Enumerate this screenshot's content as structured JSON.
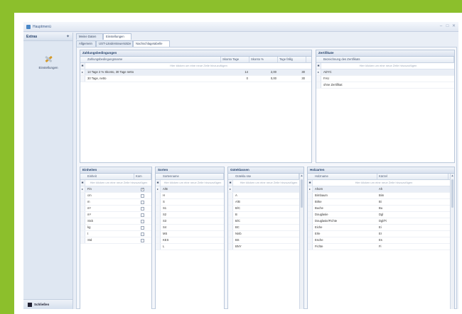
{
  "window": {
    "title": "Hauptmenü",
    "controls": [
      "–",
      "□",
      "✕"
    ]
  },
  "sidebar": {
    "header": "Extras",
    "pin": "✦",
    "item_label": "Einstellungen",
    "bottom_label": "Schließen"
  },
  "tabs_level1": [
    "Meine Daten",
    "Einstellungen"
  ],
  "tabs_level2": [
    "Allgemein",
    "UST-Ländersteuersätze",
    "Nachschlagetabelle"
  ],
  "zahlungsbedingungen": {
    "title": "Zahlungsbedingungen",
    "columns": [
      "Zahlungsbedingungsname",
      "Skonto Tage",
      "Skonto %",
      "Tage fällig"
    ],
    "new_row": "Hier klicken um eine neue Zeile hinzuzufügen",
    "rows": [
      [
        "14 Tage 2 % Skonto, 30 Tage netto",
        "14",
        "2,00",
        "30"
      ],
      [
        "30 Tage, netto",
        "0",
        "0,00",
        "30"
      ]
    ]
  },
  "zertifikate": {
    "title": "Zertifikate",
    "columns": [
      "Bezeichnung des Zertifikats"
    ],
    "new_row": "Hier klicken um eine neue Zeile hinzuzufügen",
    "rows": [
      "ADYC",
      "FAU",
      "ohne Zertifikat"
    ]
  },
  "einheiten": {
    "title": "Einheiten",
    "columns": [
      "Einheit",
      "Kom"
    ],
    "new_row": "Hier klicken um eine neue Zeile hinzuzufügen",
    "rows": [
      [
        "Fin",
        true
      ],
      [
        "cm",
        false
      ],
      [
        "m",
        false
      ],
      [
        "m²",
        false
      ],
      [
        "m³",
        false
      ],
      [
        "Stck",
        false
      ],
      [
        "kg",
        false
      ],
      [
        "t",
        false
      ],
      [
        "Std",
        false
      ]
    ]
  },
  "sorten": {
    "title": "Sorten",
    "columns": [
      "Sortenname"
    ],
    "new_row": "Hier klicken um eine neue Zeile hinzuzufügen",
    "rows": [
      "A/B",
      "H",
      "S",
      "S1",
      "S2",
      "S3",
      "S4",
      "MS",
      "KES",
      "L"
    ]
  },
  "guteklassen": {
    "title": "Güteklassen",
    "columns": [
      "Gütekla sse"
    ],
    "new_row": "Hier klicken um eine neue Zeile hinzuzufügen",
    "rows": [
      "",
      "A",
      "A/B",
      "B/C",
      "B",
      "B/C",
      "BC",
      "Ninb",
      "BS",
      "BNY"
    ]
  },
  "holzarten": {
    "title": "Holzarten",
    "columns": [
      "Holzname",
      "Kürzel"
    ],
    "new_row": "Hier klicken um eine neue Zeile hinzuzufügen",
    "rows": [
      [
        "Ahorn",
        "Ah"
      ],
      [
        "Birnbaum",
        "Bim"
      ],
      [
        "Birke",
        "Bi"
      ],
      [
        "Buche",
        "Bu"
      ],
      [
        "Douglasie",
        "Dgl"
      ],
      [
        "Douglasie/Fichte",
        "Dgl/Fi"
      ],
      [
        "Eiche",
        "Ei"
      ],
      [
        "Erle",
        "Er"
      ],
      [
        "Esche",
        "Es"
      ],
      [
        "Fichte",
        "Fi"
      ]
    ]
  }
}
